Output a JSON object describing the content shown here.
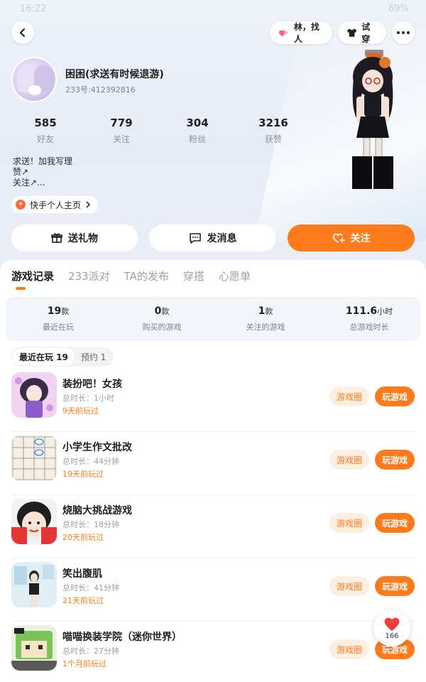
{
  "status_bar": {
    "time": "16:22",
    "battery": "69%"
  },
  "header": {
    "back_icon": "chevron-left-icon",
    "find_label": "林，找人",
    "try_on_label": "试穿",
    "more_icon": "more-icon"
  },
  "profile": {
    "username": "困困(求送有时候退游)",
    "user_id": "233号:412392816",
    "stats": [
      {
        "value": "585",
        "label": "好友"
      },
      {
        "value": "779",
        "label": "关注"
      },
      {
        "value": "304",
        "label": "粉丝"
      },
      {
        "value": "3216",
        "label": "获赞"
      }
    ],
    "bio_lines": [
      "求送！加我写理",
      "赞↗",
      "关注↗..."
    ],
    "homepage_label": "快手个人主页"
  },
  "actions": {
    "gift": "送礼物",
    "message": "发消息",
    "follow": "关注"
  },
  "tabs": [
    "游戏记录",
    "233派对",
    "TA的发布",
    "穿搭",
    "心愿单"
  ],
  "summary": [
    {
      "value": "19",
      "unit": "款",
      "label": "最近在玩"
    },
    {
      "value": "0",
      "unit": "款",
      "label": "购买的游戏"
    },
    {
      "value": "1",
      "unit": "款",
      "label": "关注的游戏"
    },
    {
      "value": "111.6",
      "unit": "小时",
      "label": "总游戏时长"
    }
  ],
  "subtabs": [
    {
      "label": "最近在玩 19"
    },
    {
      "label": "预约 1"
    }
  ],
  "games": [
    {
      "name": "装扮吧！女孩",
      "duration": "总时长：1小时",
      "last_played": "9天前玩过",
      "circle": "游戏圈",
      "play": "玩游戏"
    },
    {
      "name": "小学生作文批改",
      "duration": "总时长：44分钟",
      "last_played": "19天前玩过",
      "circle": "游戏圈",
      "play": "玩游戏"
    },
    {
      "name": "烧脑大挑战游戏",
      "duration": "总时长：18分钟",
      "last_played": "20天前玩过",
      "circle": "游戏圈",
      "play": "玩游戏"
    },
    {
      "name": "笑出腹肌",
      "duration": "总时长：41分钟",
      "last_played": "21天前玩过",
      "circle": "游戏圈",
      "play": "玩游戏"
    },
    {
      "name": "喵喵换装学院（迷你世界）",
      "duration": "总时长：27分钟",
      "last_played": "1个月前玩过",
      "circle": "游戏圈",
      "play": "玩游戏"
    }
  ],
  "like_fab": {
    "count": "166"
  },
  "colors": {
    "accent": "#ff7a1a",
    "accent_light": "#fdeee2",
    "page_bg": "#e6ecf6"
  }
}
